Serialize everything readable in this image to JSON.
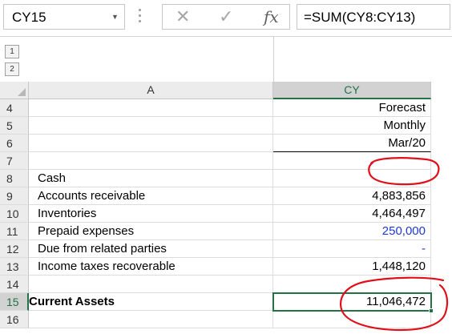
{
  "name_box": {
    "value": "CY15"
  },
  "formula_bar": {
    "cancel_icon": "cancel-x-icon",
    "enter_icon": "checkmark-icon",
    "function_label": "fx",
    "formula": "=SUM(CY8:CY13)"
  },
  "outline": {
    "levels": [
      "1",
      "2"
    ]
  },
  "columns": [
    "A",
    "CY"
  ],
  "rows": [
    {
      "num": "4",
      "label": "",
      "value": "Forecast"
    },
    {
      "num": "5",
      "label": "",
      "value": "Monthly"
    },
    {
      "num": "6",
      "label": "",
      "value": "Mar/20"
    },
    {
      "num": "7",
      "label": "",
      "value": ""
    },
    {
      "num": "8",
      "label": "Cash",
      "value": ""
    },
    {
      "num": "9",
      "label": "Accounts receivable",
      "value": "4,883,856"
    },
    {
      "num": "10",
      "label": "Inventories",
      "value": "4,464,497"
    },
    {
      "num": "11",
      "label": "Prepaid expenses",
      "value": "250,000"
    },
    {
      "num": "12",
      "label": "Due from related parties",
      "value": "-"
    },
    {
      "num": "13",
      "label": "Income taxes recoverable",
      "value": "1,448,120"
    },
    {
      "num": "14",
      "label": "",
      "value": ""
    },
    {
      "num": "15",
      "label": "Current Assets",
      "value": "11,046,472"
    },
    {
      "num": "16",
      "label": "",
      "value": ""
    }
  ],
  "colors": {
    "selection": "#217346",
    "blue_input": "#1f38d0",
    "annotation": "#e0101a"
  }
}
